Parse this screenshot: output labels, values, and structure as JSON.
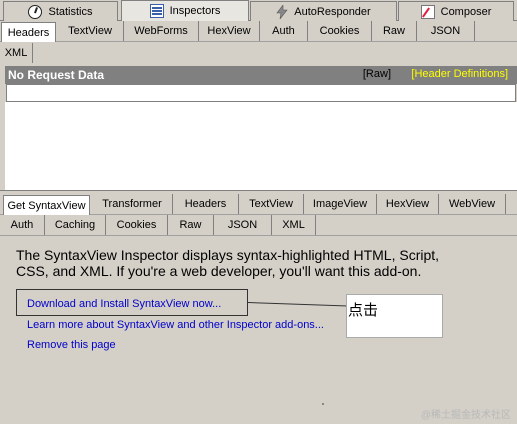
{
  "main_tabs": [
    {
      "label": "Statistics",
      "icon": "stopwatch-icon"
    },
    {
      "label": "Inspectors",
      "icon": "inspector-icon"
    },
    {
      "label": "AutoResponder",
      "icon": "lightning-icon"
    },
    {
      "label": "Composer",
      "icon": "composer-icon"
    }
  ],
  "request_tabs": [
    "Headers",
    "TextView",
    "WebForms",
    "HexView",
    "Auth",
    "Cookies",
    "Raw",
    "JSON",
    "XML"
  ],
  "request_panel": {
    "title": "No Request Data",
    "raw_link": "Raw",
    "raw_open": "[",
    "raw_close": "]",
    "header_definitions": "[Header Definitions]"
  },
  "response_tabs": [
    "Get SyntaxView",
    "Transformer",
    "Headers",
    "TextView",
    "ImageView",
    "HexView",
    "WebView",
    "Auth",
    "Caching",
    "Cookies",
    "Raw",
    "JSON",
    "XML"
  ],
  "content": {
    "description": "The SyntaxView Inspector displays syntax-highlighted HTML, Script, CSS, and XML. If you're a web developer, you'll want this add-on.",
    "download_link": "Download and Install SyntaxView now...",
    "learn_more_link": "Learn more about SyntaxView and other Inspector add-ons...",
    "remove_link": "Remove this page"
  },
  "annotation": {
    "note": "点击"
  },
  "watermark": "@稀土掘金技术社区",
  "colors": {
    "link": "#0000cc",
    "header_bar": "#808080",
    "header_definitions": "#ffff00",
    "chrome": "#d4d0c8"
  }
}
